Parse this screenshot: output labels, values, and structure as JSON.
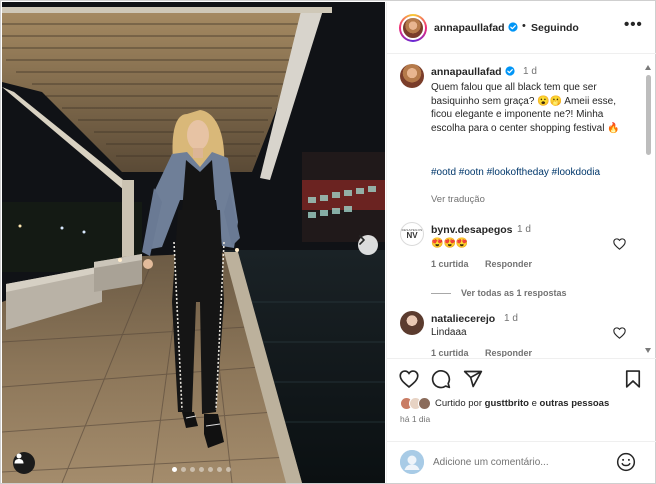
{
  "post": {
    "author": "annapaullafad",
    "follow_status": "Seguindo",
    "header_dot": "•",
    "more_label": "•••",
    "image_alt": "Mulher com look all black, calça e body preto e blazer cinza, posando em corredor externo à noite",
    "carousel": {
      "count": 7,
      "active_index": 0
    }
  },
  "caption": {
    "author": "annapaullafad",
    "time": "1 d",
    "text": "Quem falou que all black tem que ser basiquinho sem graça? 😮🫢 Ameii esse, ficou elegante e imponente ne?! Minha escolha para o center shopping festival 🔥",
    "hashtags": "#ootd #ootn #lookoftheday #lookdodia",
    "translate": "Ver tradução"
  },
  "comments": [
    {
      "author": "bynv.desapegos",
      "time": "1 d",
      "text": "😍😍😍",
      "likes": "1 curtida",
      "reply": "Responder",
      "avatar_text": "NV",
      "avatar_caption": "DESAPEGOS"
    },
    {
      "author": "nataliecerejo",
      "time": "1 d",
      "text": "Lindaaa",
      "likes": "1 curtida",
      "reply": "Responder"
    }
  ],
  "view_replies": "Ver todas as 1 respostas",
  "likes_line": {
    "prefix": "Curtido por",
    "user": "gusttbrito",
    "conjunction": "e",
    "others": "outras pessoas"
  },
  "post_time": "há 1 dia",
  "add_comment": {
    "placeholder": "Adicione um comentário..."
  },
  "icons": {
    "heart": "heart-icon",
    "comment": "comment-icon",
    "share": "paper-plane-icon",
    "save": "bookmark-icon",
    "emoji": "smiley-icon",
    "verified": "verified-badge-icon",
    "next": "chevron-right-icon",
    "tag": "user-tag-icon"
  },
  "colors": {
    "verified": "#0095f6",
    "link": "#00376b",
    "secondary_text": "#737373",
    "border": "#efefef"
  }
}
